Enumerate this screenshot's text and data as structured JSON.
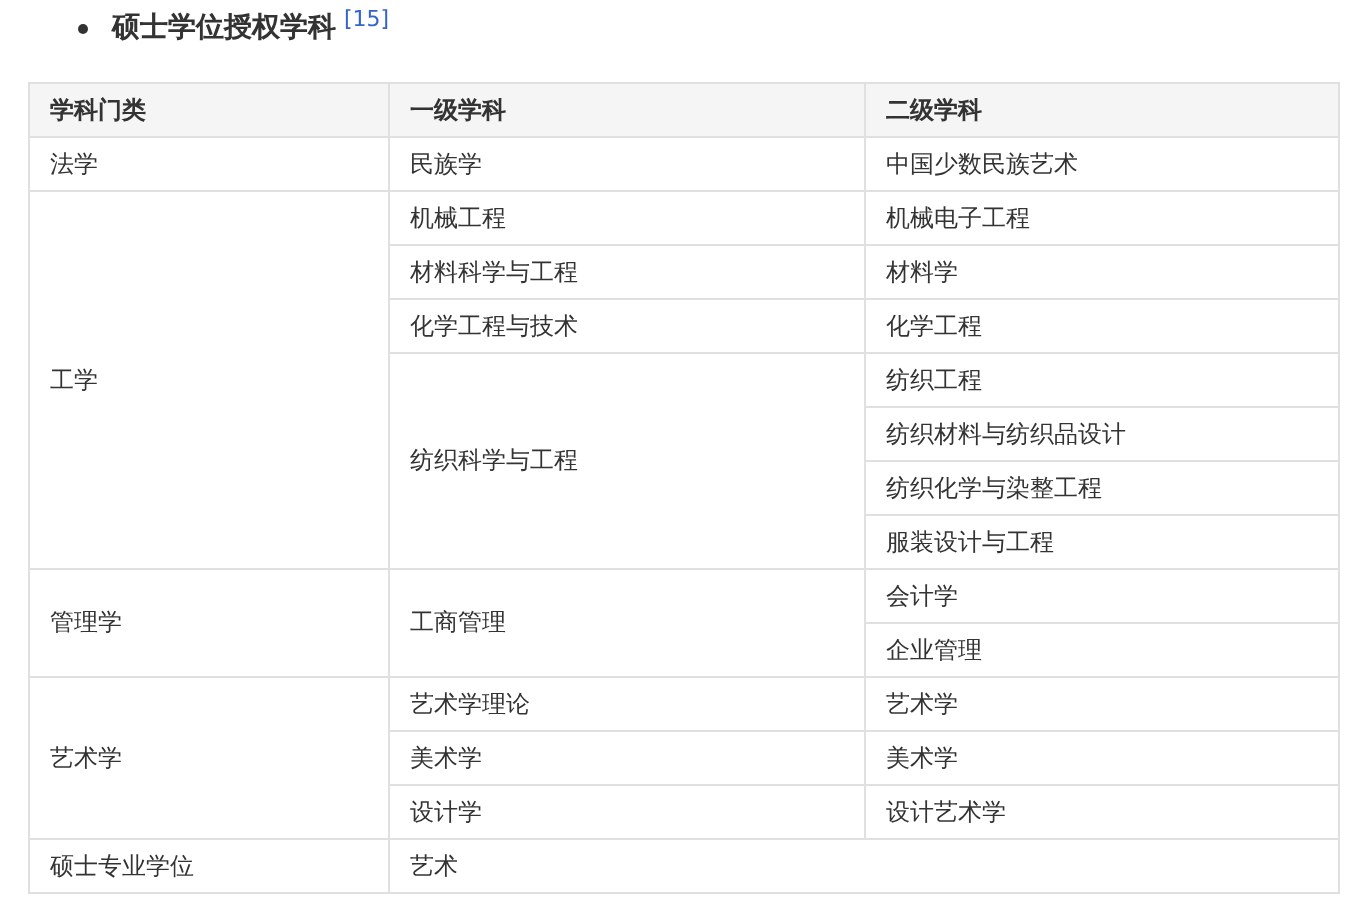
{
  "heading": {
    "text": "硕士学位授权学科",
    "reference": "[15]"
  },
  "table": {
    "columns": [
      "学科门类",
      "一级学科",
      "二级学科"
    ],
    "categories": [
      {
        "name": "法学",
        "disciplines": [
          {
            "name": "民族学",
            "subjects": [
              "中国少数民族艺术"
            ]
          }
        ]
      },
      {
        "name": "工学",
        "disciplines": [
          {
            "name": "机械工程",
            "subjects": [
              "机械电子工程"
            ]
          },
          {
            "name": "材料科学与工程",
            "subjects": [
              "材料学"
            ]
          },
          {
            "name": "化学工程与技术",
            "subjects": [
              "化学工程"
            ]
          },
          {
            "name": "纺织科学与工程",
            "subjects": [
              "纺织工程",
              "纺织材料与纺织品设计",
              "纺织化学与染整工程",
              "服装设计与工程"
            ]
          }
        ]
      },
      {
        "name": "管理学",
        "disciplines": [
          {
            "name": "工商管理",
            "subjects": [
              "会计学",
              "企业管理"
            ]
          }
        ]
      },
      {
        "name": "艺术学",
        "disciplines": [
          {
            "name": "艺术学理论",
            "subjects": [
              "艺术学"
            ]
          },
          {
            "name": "美术学",
            "subjects": [
              "美术学"
            ]
          },
          {
            "name": "设计学",
            "subjects": [
              "设计艺术学"
            ]
          }
        ]
      },
      {
        "name": "硕士专业学位",
        "disciplines": [
          {
            "name": "艺术"
          }
        ]
      }
    ]
  }
}
